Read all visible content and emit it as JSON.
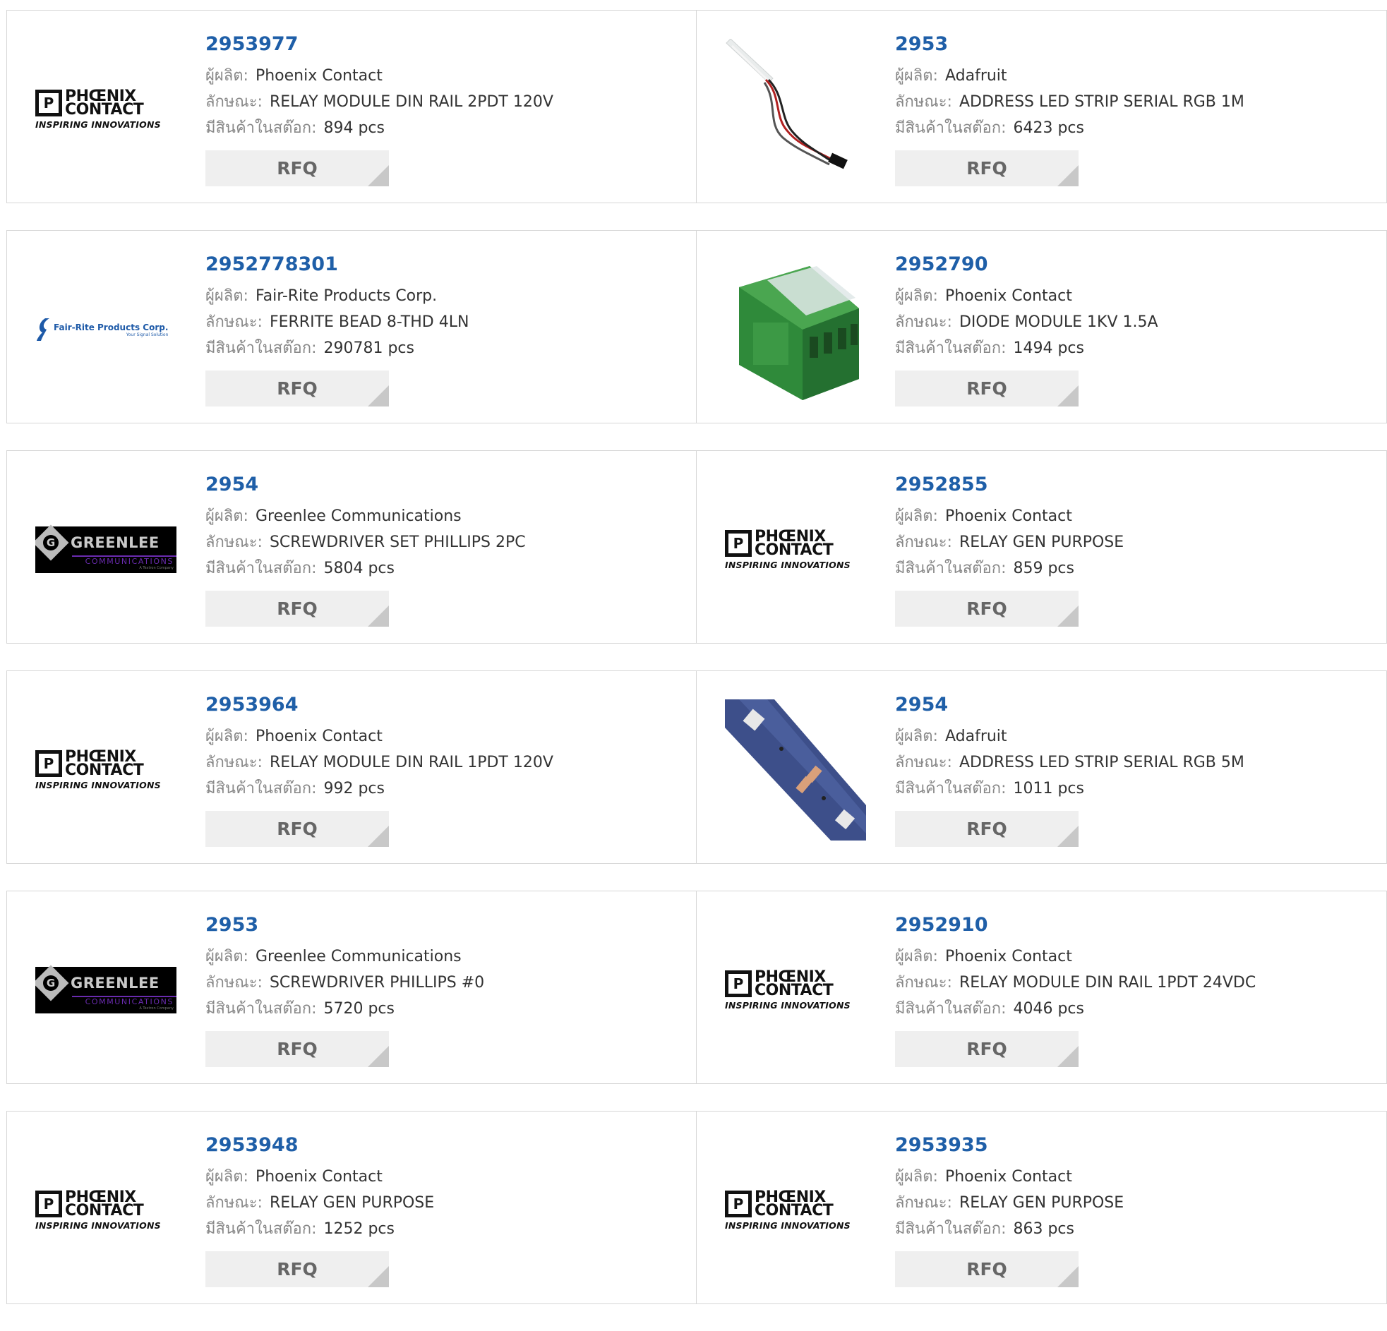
{
  "labels": {
    "manufacturer": "ผู้ผลิต:",
    "description": "ลักษณะ:",
    "stock": "มีสินค้าในสต๊อก:",
    "rfq": "RFQ"
  },
  "logos": {
    "phoenix": {
      "line1": "PHŒNIX",
      "line2": "CONTACT",
      "tagline": "INSPIRING INNOVATIONS"
    },
    "fairrite": {
      "name": "Fair-Rite Products Corp.",
      "tagline": "Your Signal Solution"
    },
    "greenlee": {
      "name": "GREENLEE",
      "sub": "COMMUNICATIONS",
      "sub2": "A Textron Company"
    }
  },
  "products": [
    {
      "part": "2953977",
      "manufacturer": "Phoenix Contact",
      "description": "RELAY MODULE DIN RAIL 2PDT 120V",
      "stock": "894 pcs",
      "image": "phoenix-logo"
    },
    {
      "part": "2953",
      "manufacturer": "Adafruit",
      "description": "ADDRESS LED STRIP SERIAL RGB 1M",
      "stock": "6423 pcs",
      "image": "led-strip-cable-photo"
    },
    {
      "part": "2952778301",
      "manufacturer": "Fair-Rite Products Corp.",
      "description": "FERRITE BEAD 8-THD 4LN",
      "stock": "290781 pcs",
      "image": "fairrite-logo"
    },
    {
      "part": "2952790",
      "manufacturer": "Phoenix Contact",
      "description": "DIODE MODULE 1KV 1.5A",
      "stock": "1494 pcs",
      "image": "green-din-module-photo"
    },
    {
      "part": "2954",
      "manufacturer": "Greenlee Communications",
      "description": "SCREWDRIVER SET PHILLIPS 2PC",
      "stock": "5804 pcs",
      "image": "greenlee-logo"
    },
    {
      "part": "2952855",
      "manufacturer": "Phoenix Contact",
      "description": "RELAY GEN PURPOSE",
      "stock": "859 pcs",
      "image": "phoenix-logo"
    },
    {
      "part": "2953964",
      "manufacturer": "Phoenix Contact",
      "description": "RELAY MODULE DIN RAIL 1PDT 120V",
      "stock": "992 pcs",
      "image": "phoenix-logo"
    },
    {
      "part": "2954",
      "manufacturer": "Adafruit",
      "description": "ADDRESS LED STRIP SERIAL RGB 5M",
      "stock": "1011 pcs",
      "image": "led-strip-closeup-photo"
    },
    {
      "part": "2953",
      "manufacturer": "Greenlee Communications",
      "description": "SCREWDRIVER PHILLIPS #0",
      "stock": "5720 pcs",
      "image": "greenlee-logo"
    },
    {
      "part": "2952910",
      "manufacturer": "Phoenix Contact",
      "description": "RELAY MODULE DIN RAIL 1PDT 24VDC",
      "stock": "4046 pcs",
      "image": "phoenix-logo"
    },
    {
      "part": "2953948",
      "manufacturer": "Phoenix Contact",
      "description": "RELAY GEN PURPOSE",
      "stock": "1252 pcs",
      "image": "phoenix-logo"
    },
    {
      "part": "2953935",
      "manufacturer": "Phoenix Contact",
      "description": "RELAY GEN PURPOSE",
      "stock": "863 pcs",
      "image": "phoenix-logo"
    }
  ],
  "colors": {
    "part_link": "#1f5fa8",
    "label": "#888888",
    "rfq_bg": "#efefef",
    "border": "#d6d6d6"
  }
}
